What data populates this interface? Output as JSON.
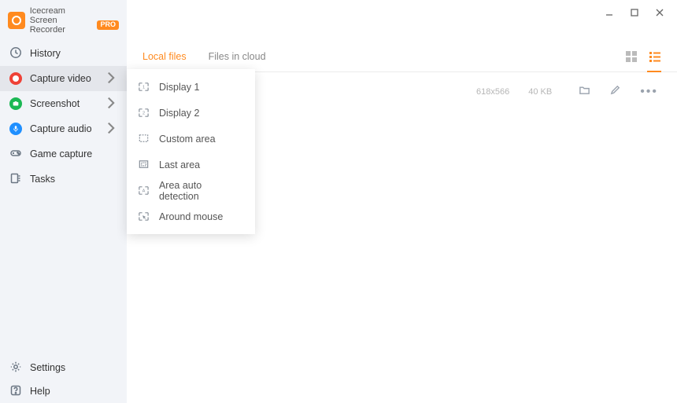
{
  "app": {
    "name": "Icecream",
    "subtitle": "Screen Recorder",
    "badge": "PRO"
  },
  "sidebar": {
    "items": [
      {
        "label": "History"
      },
      {
        "label": "Capture video"
      },
      {
        "label": "Screenshot"
      },
      {
        "label": "Capture audio"
      },
      {
        "label": "Game capture"
      },
      {
        "label": "Tasks"
      }
    ],
    "footer": [
      {
        "label": "Settings"
      },
      {
        "label": "Help"
      }
    ]
  },
  "tabs": [
    {
      "label": "Local files"
    },
    {
      "label": "Files in cloud"
    }
  ],
  "file": {
    "dimensions": "618x566",
    "size": "40 KB"
  },
  "submenu": [
    {
      "label": "Display 1"
    },
    {
      "label": "Display 2"
    },
    {
      "label": "Custom area"
    },
    {
      "label": "Last area"
    },
    {
      "label": "Area auto detection"
    },
    {
      "label": "Around mouse"
    }
  ]
}
